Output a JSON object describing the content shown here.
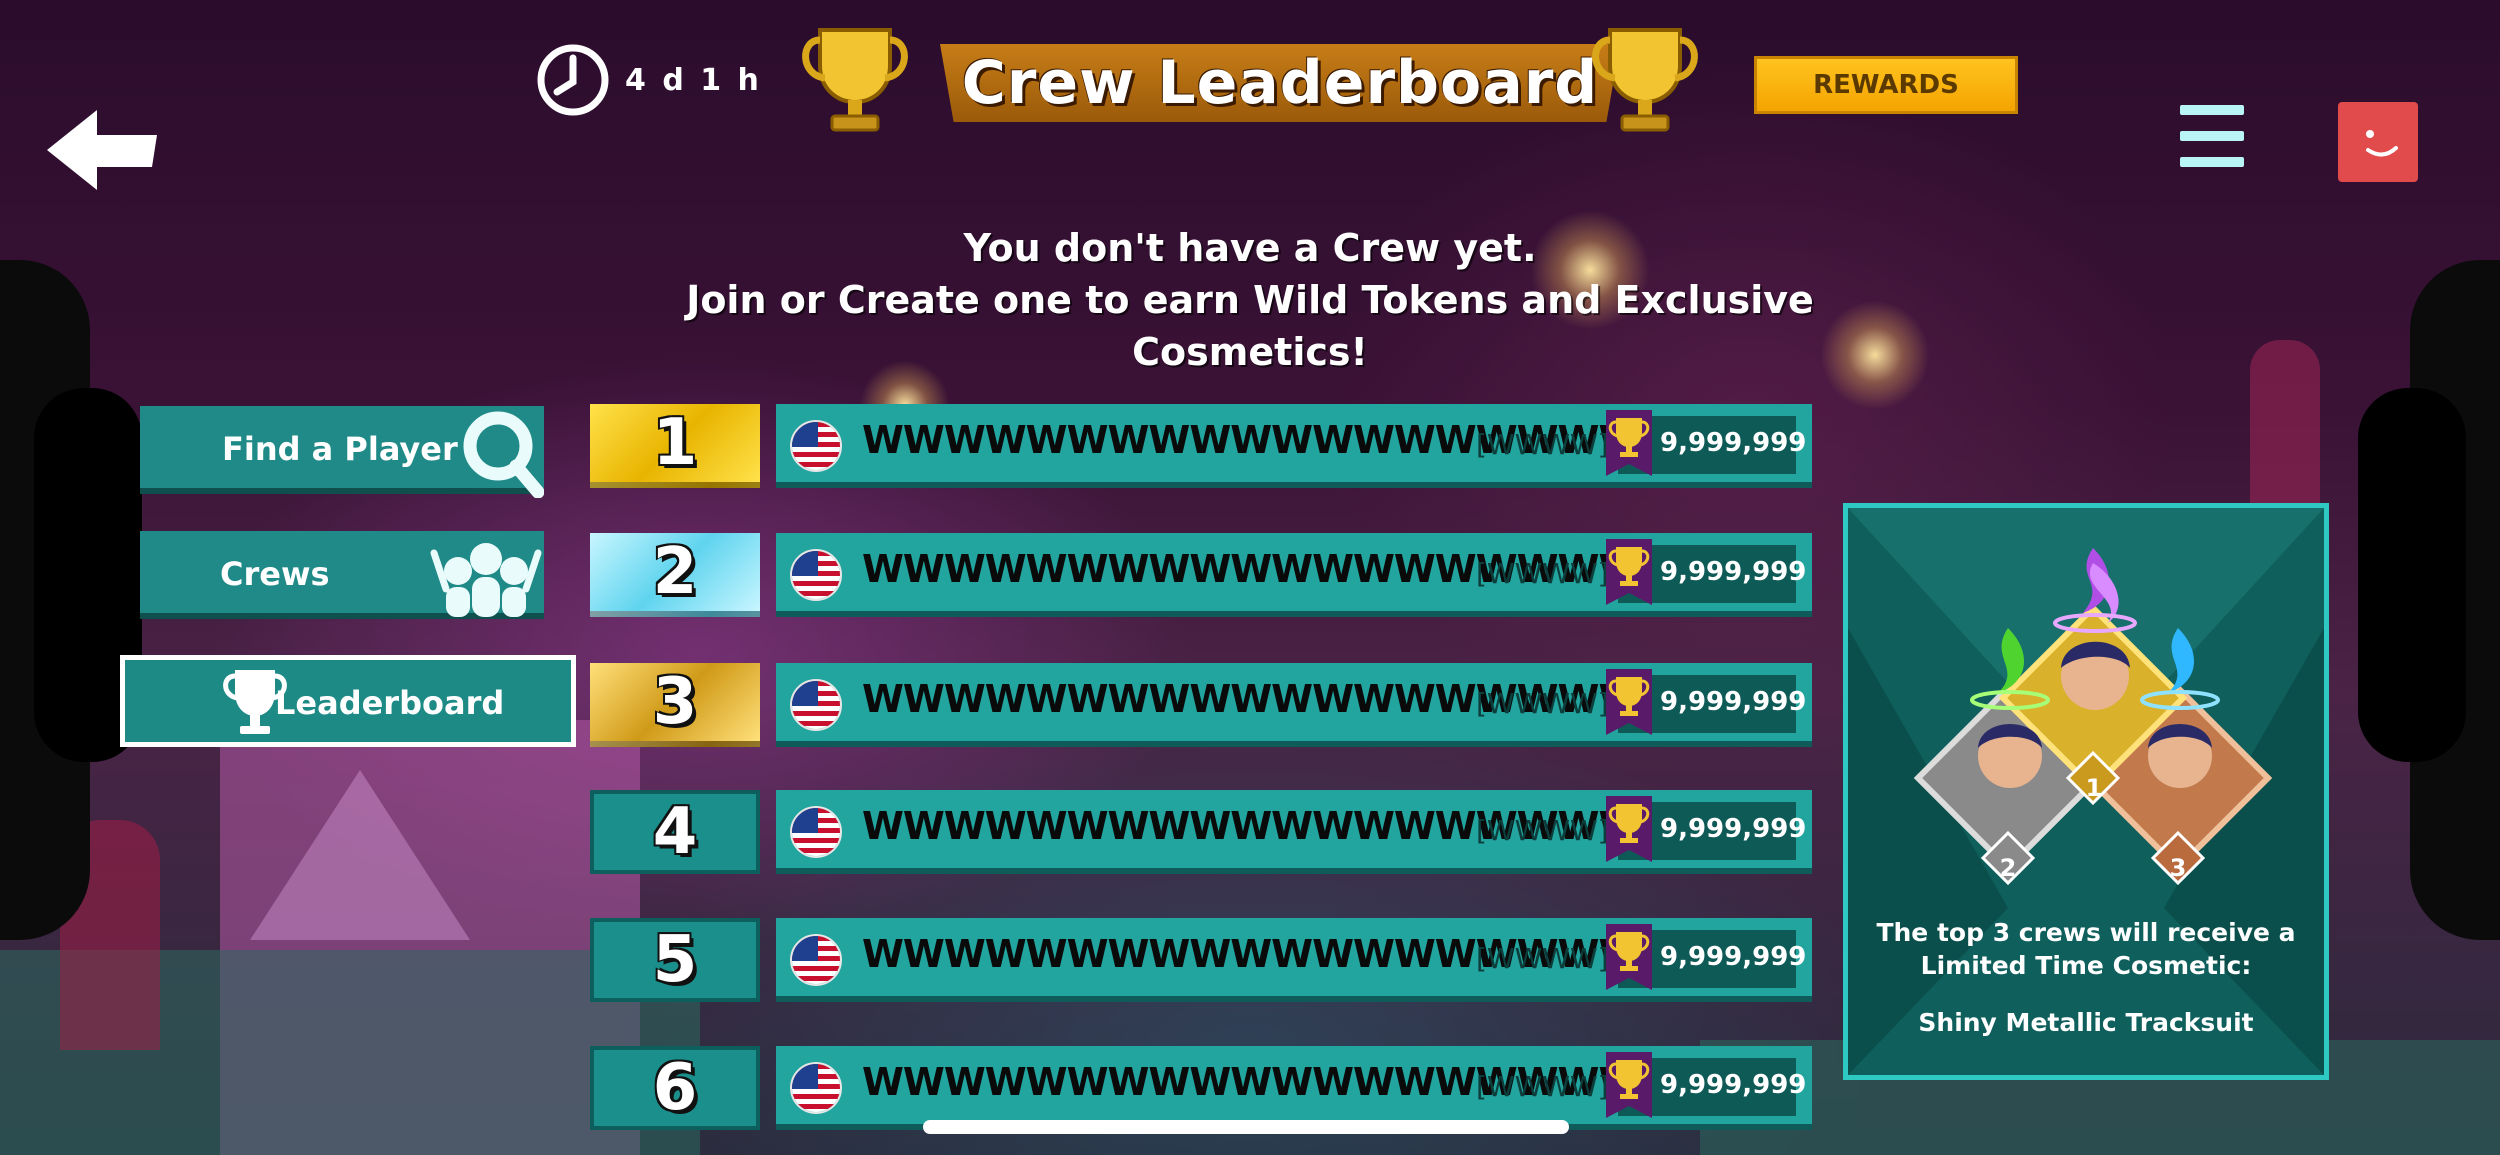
{
  "header": {
    "timer": "4 d 1 h",
    "title": "Crew Leaderboard",
    "rewards_label": "REWARDS"
  },
  "icons": {
    "back": "back-arrow-icon",
    "clock": "clock-icon",
    "trophy": "trophy-icon",
    "menu": "hamburger-menu-icon",
    "profile": "profile-avatar-icon",
    "search": "magnifier-icon",
    "crews": "crowd-icon",
    "flag": "us-flag-icon"
  },
  "message": {
    "line1": "You don't have a Crew yet.",
    "line2": "Join or Create one to earn Wild Tokens and Exclusive Cosmetics!"
  },
  "nav": [
    {
      "label": "Find a Player",
      "active": false
    },
    {
      "label": "Crews",
      "active": false
    },
    {
      "label": "Leaderboard",
      "active": true
    }
  ],
  "leaderboard": [
    {
      "rank": "1",
      "name": "WWWWWWWWWWWWWWWWWWWWWW",
      "tag": "[WWWW]",
      "score": "9,999,999",
      "medal": "gold"
    },
    {
      "rank": "2",
      "name": "WWWWWWWWWWWWWWWWWWWWWW",
      "tag": "[WWWW]",
      "score": "9,999,999",
      "medal": "silver"
    },
    {
      "rank": "3",
      "name": "WWWWWWWWWWWWWWWWWWWWWW",
      "tag": "[WWWW]",
      "score": "9,999,999",
      "medal": "bronze"
    },
    {
      "rank": "4",
      "name": "WWWWWWWWWWWWWWWWWWWWWW",
      "tag": "[WWWW]",
      "score": "9,999,999",
      "medal": "none"
    },
    {
      "rank": "5",
      "name": "WWWWWWWWWWWWWWWWWWWWWW",
      "tag": "[WWWW]",
      "score": "9,999,999",
      "medal": "none"
    },
    {
      "rank": "6",
      "name": "WWWWWWWWWWWWWWWWWWWWWW",
      "tag": "[WWWW]",
      "score": "9,999,999",
      "medal": "none"
    }
  ],
  "reward_panel": {
    "badge_1": "1",
    "badge_2": "2",
    "badge_3": "3",
    "caption_line1": "The top 3 crews will receive a",
    "caption_line2": "Limited Time Cosmetic:",
    "item": "Shiny Metallic Tracksuit"
  },
  "colors": {
    "teal": "#22a49f",
    "teal_dark": "#0f5b59",
    "gold": "#f5a400",
    "title_bar": "#b06a10",
    "avatar": "#e24b4b"
  }
}
